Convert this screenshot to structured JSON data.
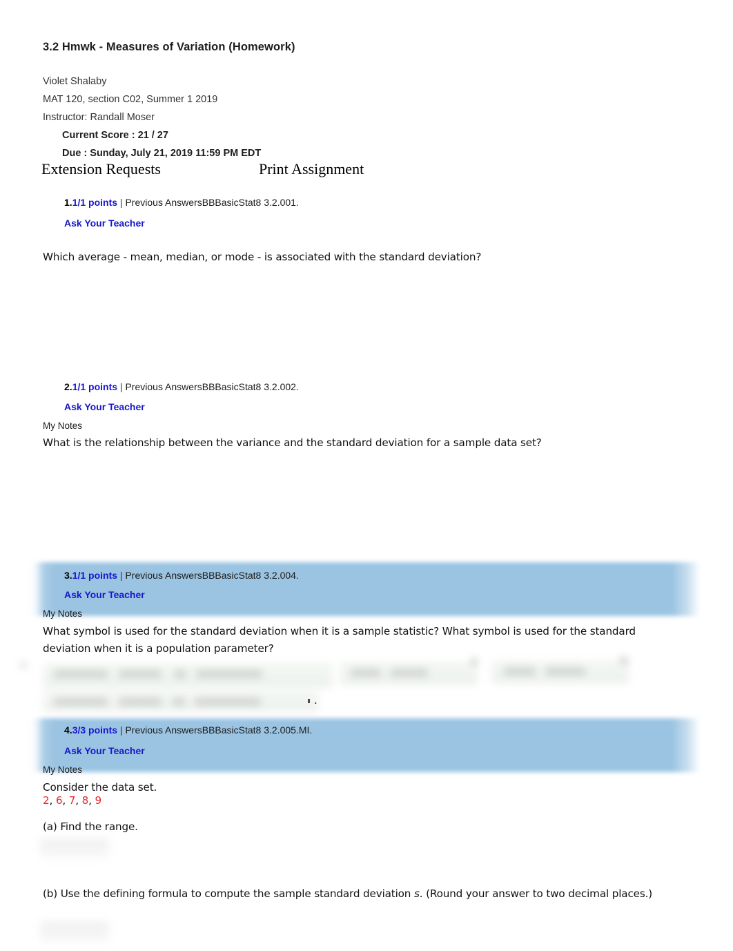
{
  "header": {
    "title": "3.2 Hmwk - Measures of Variation (Homework)",
    "student": "Violet Shalaby",
    "course": "MAT 120, section C02, Summer 1 2019",
    "instructor": "Instructor: Randall Moser",
    "current_score": "Current Score : 21 / 27",
    "due": "Due : Sunday, July 21, 2019 11:59 PM EDT"
  },
  "actions": {
    "extension_requests": "Extension Requests",
    "print_assignment": "Print Assignment"
  },
  "labels": {
    "my_notes": "My Notes",
    "ask_your_teacher": "Ask Your Teacher",
    "pipe": " | ",
    "previous_answers": "Previous Answers"
  },
  "questions": [
    {
      "number": "1.",
      "points": "1/1 points",
      "pipe": " | ",
      "source": "Previous AnswersBBBasicStat8 3.2.001.",
      "ask": "Ask Your Teacher",
      "has_notes": false,
      "highlighted": false,
      "prompt": "Which average - mean, median, or mode - is associated with the standard deviation?"
    },
    {
      "number": "2.",
      "points": "1/1 points",
      "pipe": " | ",
      "source": "Previous AnswersBBBasicStat8 3.2.002.",
      "ask": "Ask Your Teacher",
      "has_notes": true,
      "notes": "My Notes",
      "highlighted": false,
      "prompt": "What is the relationship between the variance and the standard deviation for a sample data set?"
    },
    {
      "number": "3.",
      "points": "1/1 points",
      "pipe": " | ",
      "source": "Previous AnswersBBBasicStat8 3.2.004.",
      "ask": "Ask Your Teacher",
      "has_notes": true,
      "notes": "My Notes",
      "highlighted": true,
      "prompt": "What symbol is used for the standard deviation when it is a sample statistic? What symbol is used for the standard deviation when it is a population parameter?"
    },
    {
      "number": "4.",
      "points": "3/3 points",
      "pipe": " | ",
      "source": "Previous AnswersBBBasicStat8 3.2.005.MI.",
      "ask": "Ask Your Teacher",
      "has_notes": true,
      "notes": "My Notes",
      "highlighted": true,
      "prompt": "Consider the data set.",
      "dataset": {
        "values": [
          "2",
          "6",
          "7",
          "8",
          "9"
        ],
        "separator": ", ",
        "color": "#e8252b"
      },
      "parts": [
        {
          "label": "(a) Find the range.",
          "pre": "(a) Find the range.",
          "italic": "",
          "post": ""
        },
        {
          "label": "(b) Use the defining formula to compute the sample standard deviation s. (Round your answer to two decimal places.)",
          "pre": "(b) Use the defining formula to compute the sample standard deviation ",
          "italic": "s",
          "post": ". (Round your answer to two decimal places.)"
        }
      ]
    }
  ],
  "colors": {
    "highlight": "#9bc4e2",
    "link_blue": "#1616cc",
    "points_blue": "#1616d0",
    "dataset_red": "#e8252b",
    "text": "#1a1a1a"
  }
}
